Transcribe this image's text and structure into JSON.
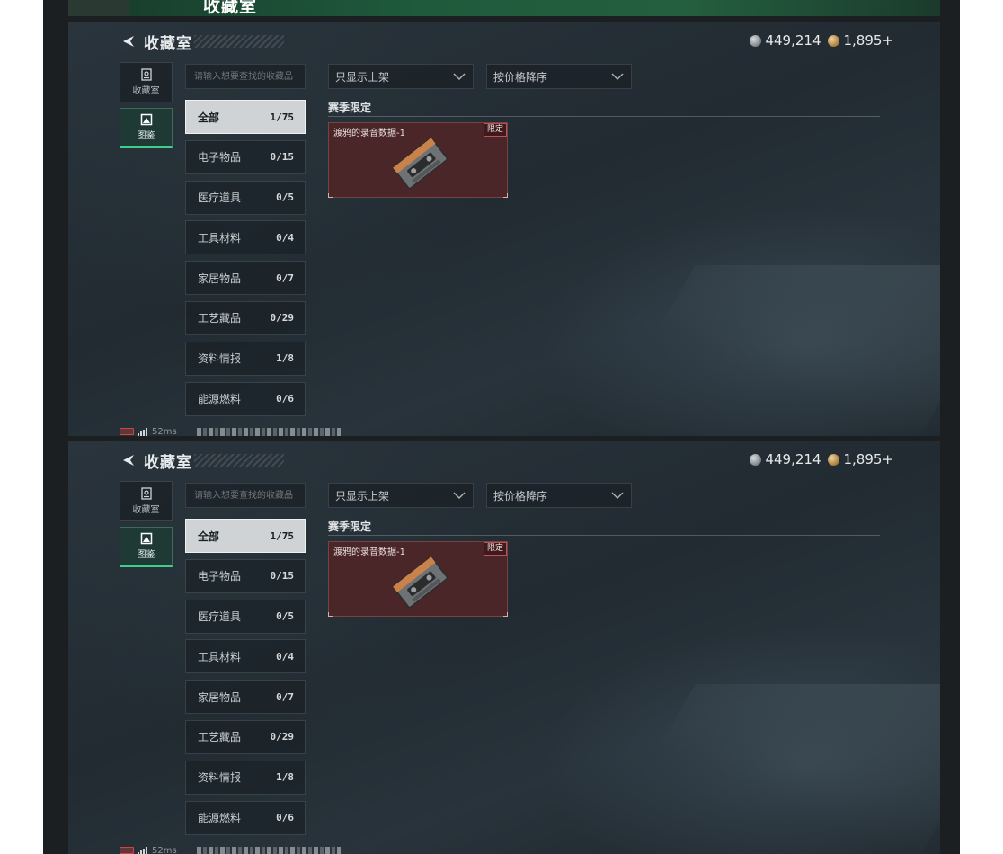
{
  "top_banner": {
    "title": "收藏室"
  },
  "screens": [
    {
      "header": {
        "title": "收藏室"
      },
      "currency": {
        "silver": "449,214",
        "gold": "1,895+"
      },
      "side_nav": [
        {
          "label": "收藏室",
          "icon": "vault-icon",
          "active": false
        },
        {
          "label": "图鉴",
          "icon": "codex-icon",
          "active": true
        }
      ],
      "search": {
        "placeholder": "请输入想要查找的收藏品"
      },
      "filters": {
        "display": "只显示上架",
        "sort": "按价格降序"
      },
      "categories": [
        {
          "name": "全部",
          "count": "1/75",
          "active": true
        },
        {
          "name": "电子物品",
          "count": "0/15"
        },
        {
          "name": "医疗道具",
          "count": "0/5"
        },
        {
          "name": "工具材料",
          "count": "0/4"
        },
        {
          "name": "家居物品",
          "count": "0/7"
        },
        {
          "name": "工艺藏品",
          "count": "0/29"
        },
        {
          "name": "资料情报",
          "count": "1/8"
        },
        {
          "name": "能源燃料",
          "count": "0/6"
        }
      ],
      "section": {
        "title": "赛季限定"
      },
      "item": {
        "name": "渡鸦的录音数据-1",
        "badge": "限定",
        "icon": "cassette-tape-icon"
      },
      "status": {
        "ping": "52ms"
      }
    },
    {
      "header": {
        "title": "收藏室"
      },
      "currency": {
        "silver": "449,214",
        "gold": "1,895+"
      },
      "side_nav": [
        {
          "label": "收藏室",
          "icon": "vault-icon",
          "active": false
        },
        {
          "label": "图鉴",
          "icon": "codex-icon",
          "active": true
        }
      ],
      "search": {
        "placeholder": "请输入想要查找的收藏品"
      },
      "filters": {
        "display": "只显示上架",
        "sort": "按价格降序"
      },
      "categories": [
        {
          "name": "全部",
          "count": "1/75",
          "active": true
        },
        {
          "name": "电子物品",
          "count": "0/15"
        },
        {
          "name": "医疗道具",
          "count": "0/5"
        },
        {
          "name": "工具材料",
          "count": "0/4"
        },
        {
          "name": "家居物品",
          "count": "0/7"
        },
        {
          "name": "工艺藏品",
          "count": "0/29"
        },
        {
          "name": "资料情报",
          "count": "1/8"
        },
        {
          "name": "能源燃料",
          "count": "0/6"
        }
      ],
      "section": {
        "title": "赛季限定"
      },
      "item": {
        "name": "渡鸦的录音数据-1",
        "badge": "限定",
        "icon": "cassette-tape-icon"
      },
      "status": {
        "ping": "52ms"
      }
    }
  ],
  "colors": {
    "accent": "#3fcf8a",
    "item_bg": "#4a2628",
    "badge_border": "#b8545a",
    "panel_bg": "#222b32"
  }
}
